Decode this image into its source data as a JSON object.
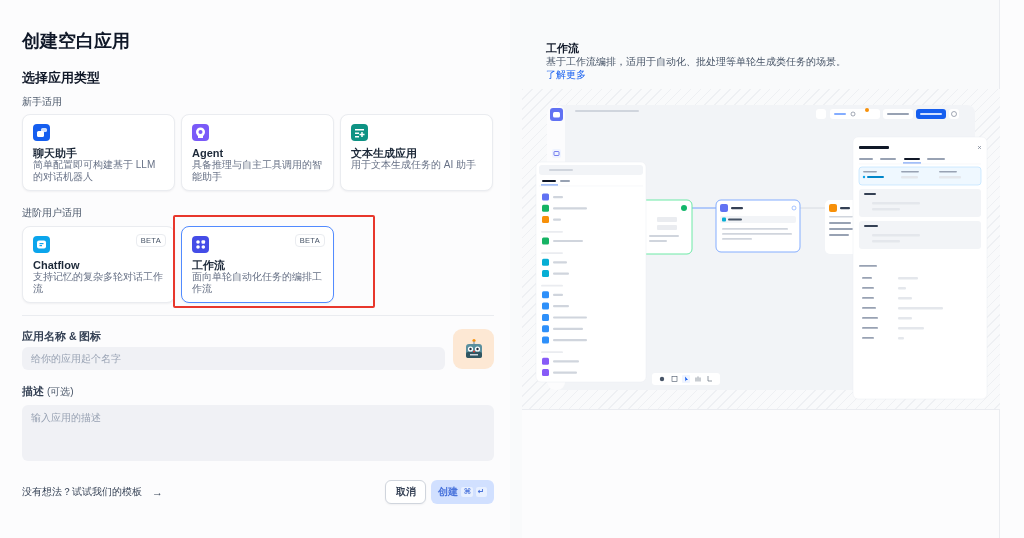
{
  "title": "创建空白应用",
  "section_title": "选择应用类型",
  "groups": [
    {
      "label": "新手适用",
      "cards": [
        {
          "kind": "chat",
          "color": "#155eef",
          "title": "聊天助手",
          "description": "简单配置即可构建基于 LLM 的对话机器人",
          "selected": false,
          "highlighted": false
        },
        {
          "kind": "agent",
          "color": "#7a5af8",
          "title": "Agent",
          "description": "具备推理与自主工具调用的智能助手",
          "selected": false,
          "highlighted": false
        },
        {
          "kind": "text",
          "color": "#0e9384",
          "title": "文本生成应用",
          "description": "用于文本生成任务的 AI 助手",
          "selected": false,
          "highlighted": false
        }
      ]
    },
    {
      "label": "进阶用户适用",
      "cards": [
        {
          "kind": "chatflow",
          "color": "#0ba5ec",
          "title": "Chatflow",
          "description": "支持记忆的复杂多轮对话工作流",
          "badge": "BETA",
          "selected": false,
          "highlighted": false
        },
        {
          "kind": "workflow",
          "color": "#444ce7",
          "title": "工作流",
          "description": "面向单轮自动化任务的编排工作流",
          "badge": "BETA",
          "selected": true,
          "highlighted": true
        }
      ]
    }
  ],
  "form": {
    "name_label": "应用名称 & 图标",
    "name_placeholder": "给你的应用起个名字",
    "description_label": "描述",
    "description_optional": "(可选)",
    "description_placeholder": "输入应用的描述",
    "template_link": "没有想法？试试我们的模板",
    "template_arrow": "→",
    "cancel": "取消",
    "create": {
      "label": "创建",
      "disabled": true,
      "keys": [
        "⌘",
        "↵"
      ]
    }
  },
  "preview": {
    "title": "工作流",
    "description": "基于工作流编排，适用于自动化、批处理等单轮生成类任务的场景。",
    "link": "了解更多"
  }
}
